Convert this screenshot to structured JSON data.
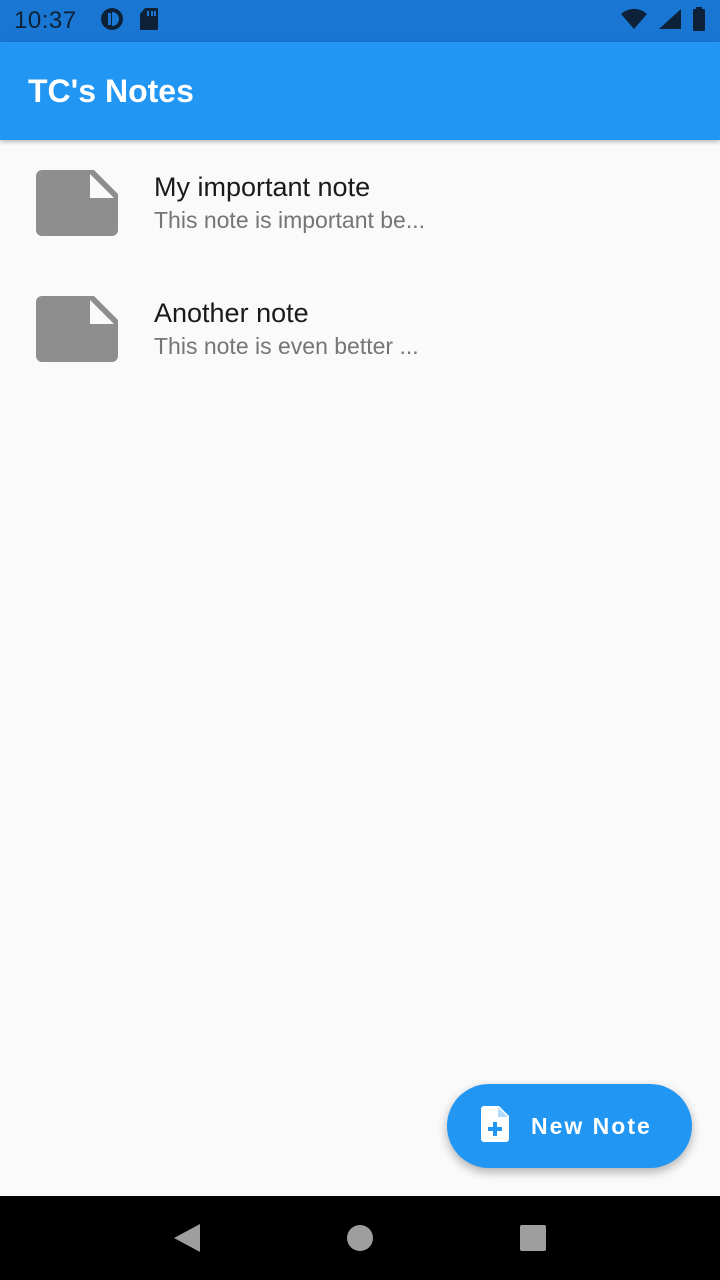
{
  "status_bar": {
    "time": "10:37",
    "icons": [
      "data-saver-icon",
      "sd-card-icon",
      "wifi-icon",
      "cell-signal-icon",
      "battery-icon"
    ]
  },
  "app_bar": {
    "title": "TC's Notes",
    "color": "#2196f3"
  },
  "notes": [
    {
      "title": "My important note",
      "subtitle": "This note is important be...",
      "icon": "note-icon"
    },
    {
      "title": "Another note",
      "subtitle": "This note is even better ...",
      "icon": "note-icon"
    }
  ],
  "fab": {
    "label": "New Note",
    "icon": "note-add-icon"
  },
  "nav_bar": {
    "buttons": [
      "back-icon",
      "home-icon",
      "recents-icon"
    ]
  }
}
